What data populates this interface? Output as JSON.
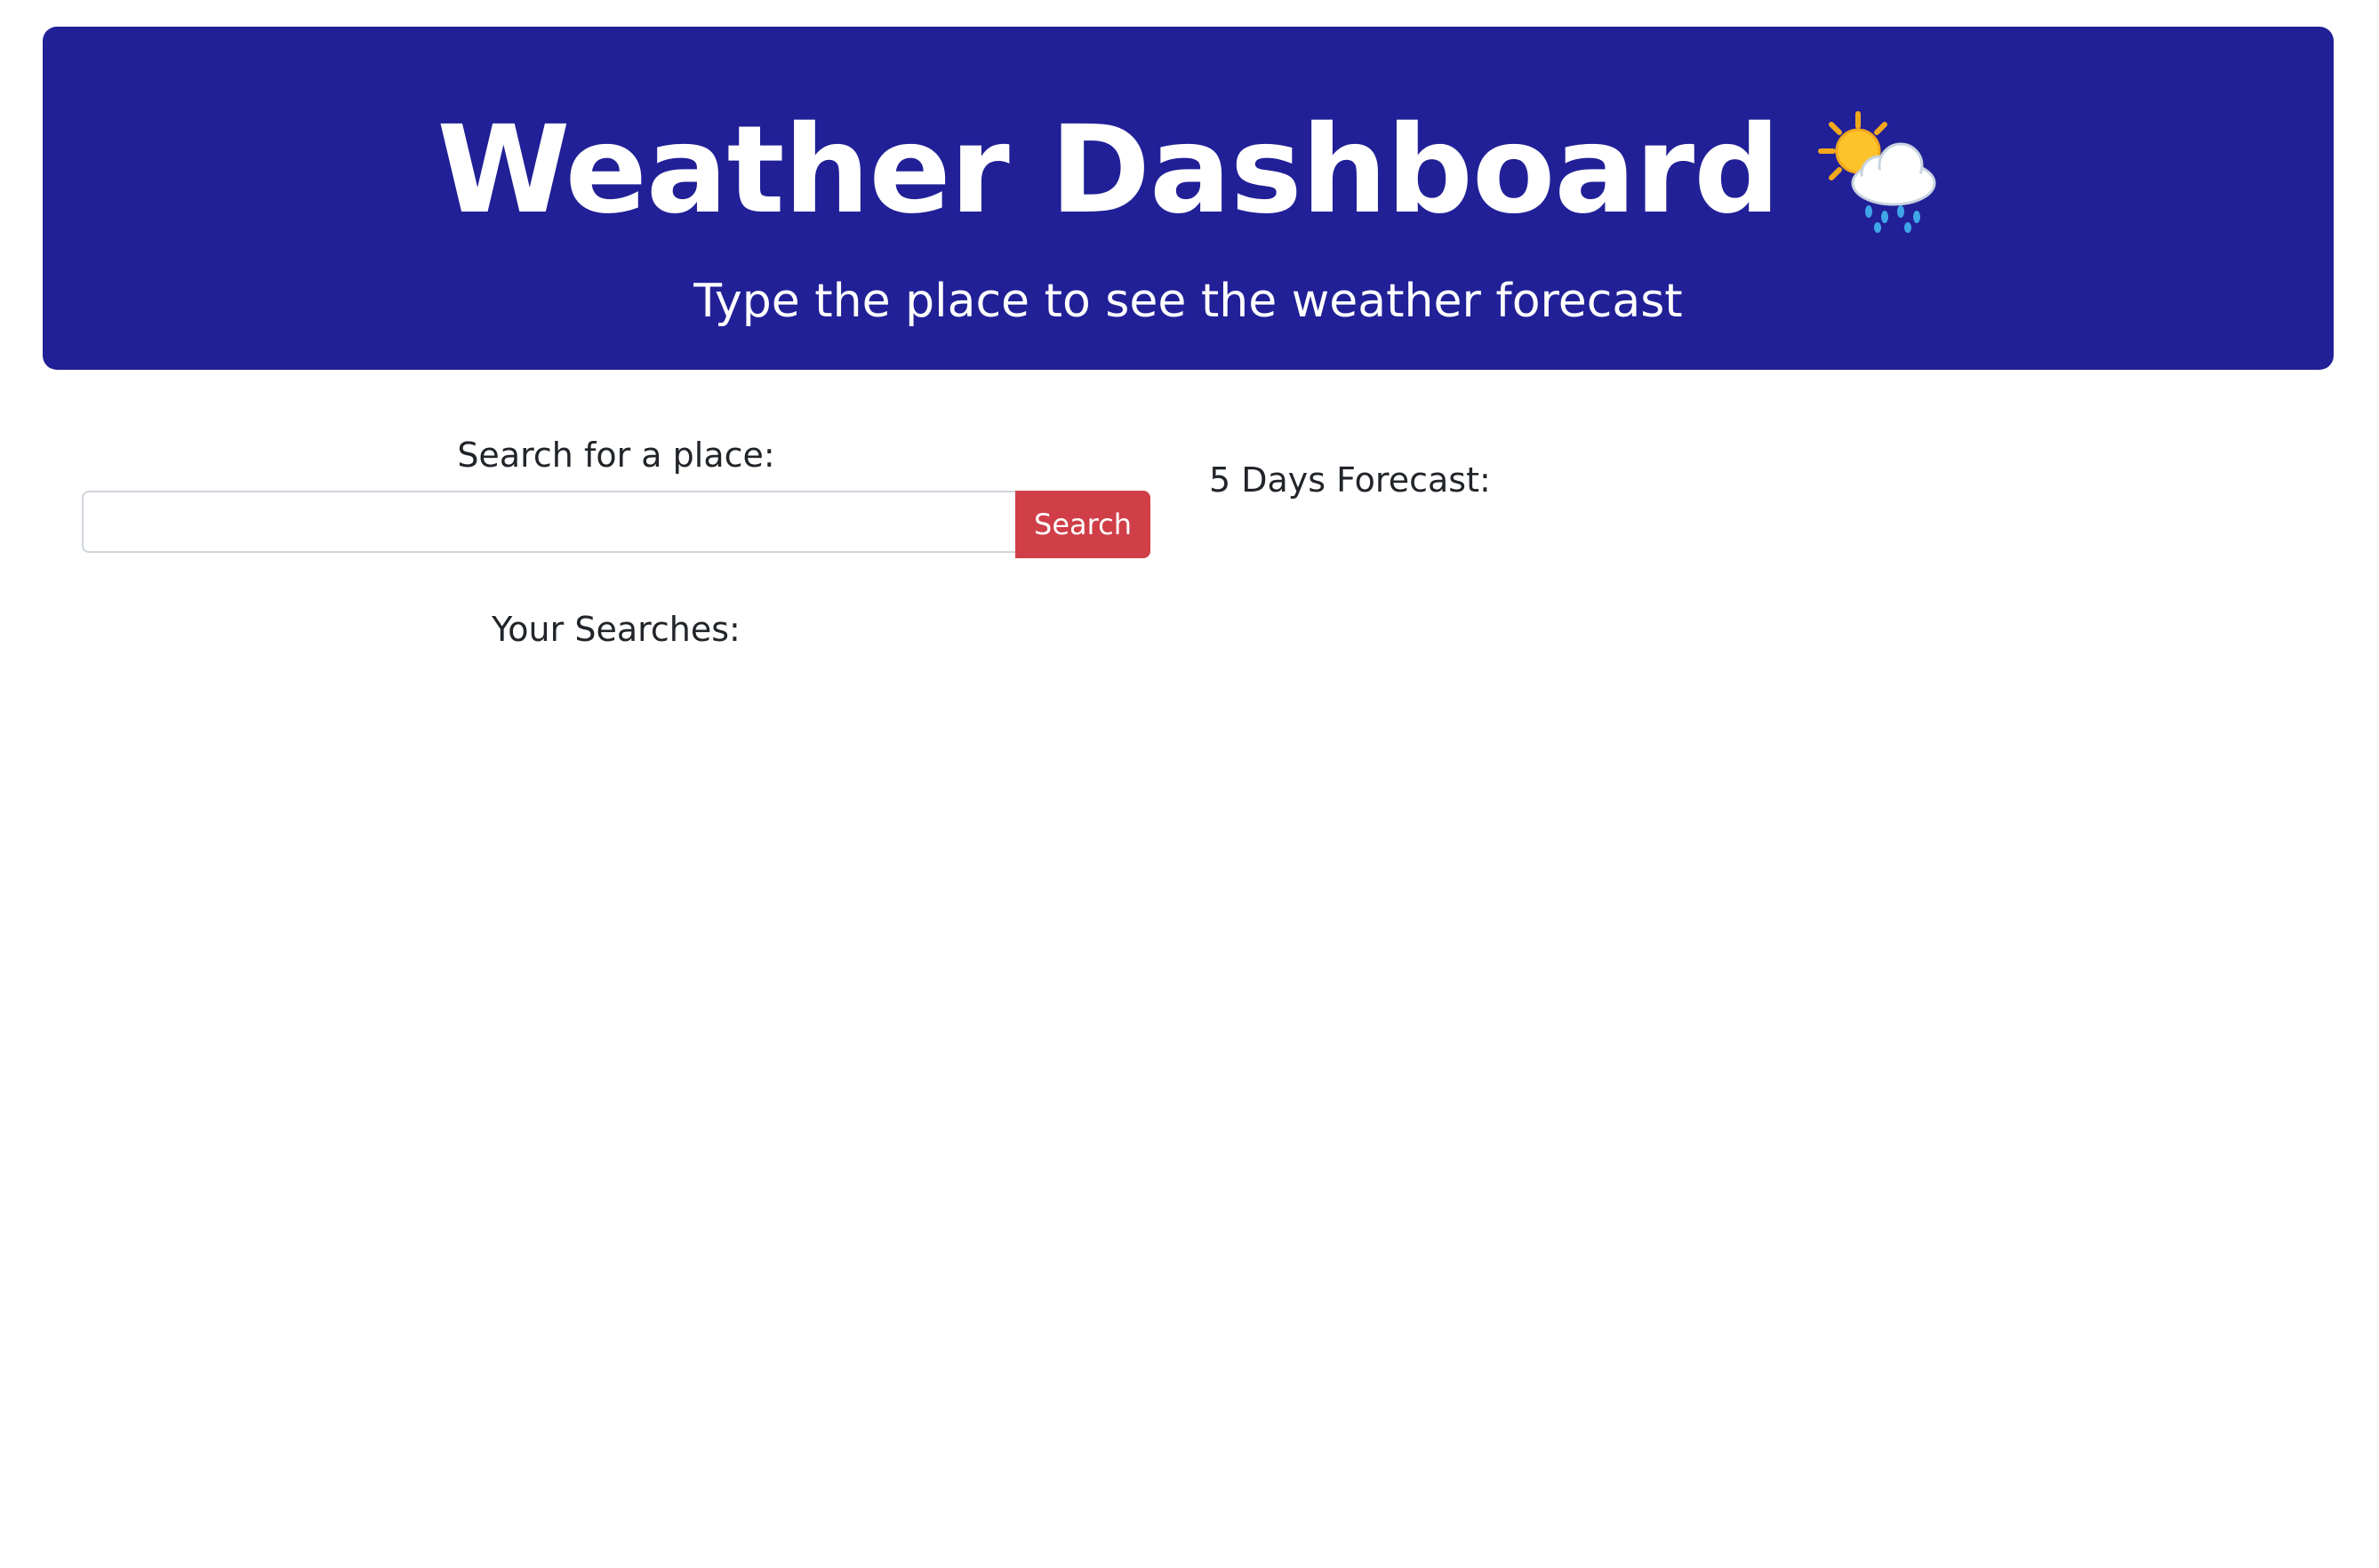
{
  "header": {
    "title": "Weather Dashboard",
    "title_icon": "sun-behind-rain-cloud-icon",
    "subtitle": "Type the place to see the weather forecast"
  },
  "search": {
    "label": "Search for a place:",
    "input_value": "",
    "placeholder": "",
    "button_label": "Search"
  },
  "history": {
    "label": "Your Searches:",
    "items": []
  },
  "forecast": {
    "label": "5 Days Forecast:",
    "days": []
  },
  "colors": {
    "header_background": "#212097",
    "search_button": "#d03f48",
    "text": "#212529"
  }
}
